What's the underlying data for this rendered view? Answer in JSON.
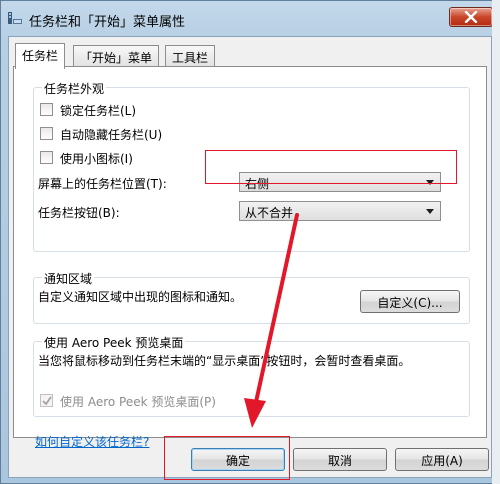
{
  "window": {
    "title": "任务栏和「开始」菜单属性"
  },
  "tabs": [
    {
      "label": "任务栏",
      "active": true
    },
    {
      "label": "「开始」菜单",
      "active": false
    },
    {
      "label": "工具栏",
      "active": false
    }
  ],
  "appearance": {
    "title": "任务栏外观",
    "lock_taskbar": "锁定任务栏(L)",
    "auto_hide": "自动隐藏任务栏(U)",
    "small_icons": "使用小图标(I)",
    "position_label": "屏幕上的任务栏位置(T):",
    "position_value": "右侧",
    "buttons_label": "任务栏按钮(B):",
    "buttons_value": "从不合并"
  },
  "notification": {
    "title": "通知区域",
    "description": "自定义通知区域中出现的图标和通知。",
    "customize_button": "自定义(C)..."
  },
  "aero_peek": {
    "title": "使用 Aero Peek 预览桌面",
    "description": "当您将鼠标移动到任务栏末端的“显示桌面”按钮时，会暂时查看桌面。",
    "checkbox_label": "使用 Aero Peek 预览桌面(P)"
  },
  "help_link": "如何自定义该任务栏?",
  "footer": {
    "ok": "确定",
    "cancel": "取消",
    "apply": "应用(A)"
  },
  "colors": {
    "annotation_red": "#e2172a",
    "link_blue": "#0066cc"
  }
}
